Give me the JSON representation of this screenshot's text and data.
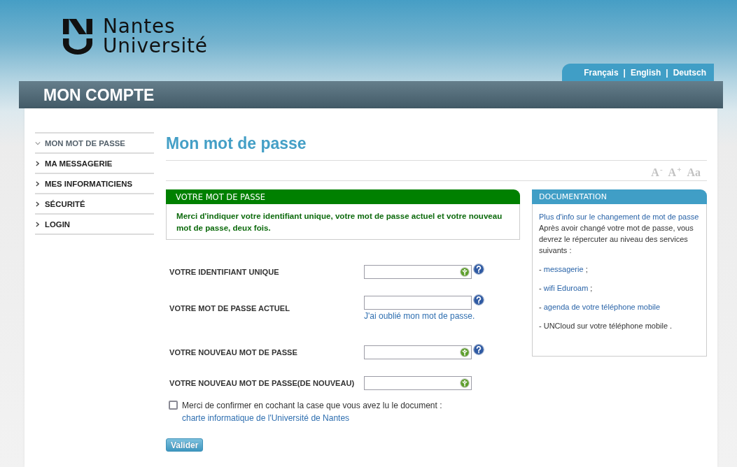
{
  "header": {
    "logo": {
      "lines": [
        "Nantes",
        "Université"
      ]
    },
    "languages": [
      {
        "kind": "link",
        "text": "Français"
      },
      {
        "kind": "separator",
        "text": "|"
      },
      {
        "kind": "link",
        "text": "English"
      },
      {
        "kind": "separator",
        "text": "|"
      },
      {
        "kind": "link",
        "text": "Deutsch"
      }
    ]
  },
  "banner": {
    "title": "MON COMPTE"
  },
  "sidebar": {
    "items": [
      {
        "label": "MON MOT DE PASSE",
        "selected": true
      },
      {
        "label": "MA MESSAGERIE",
        "selected": false
      },
      {
        "label": "MES INFORMATICIENS",
        "selected": false
      },
      {
        "label": "SÉCURITÉ",
        "selected": false
      },
      {
        "label": "LOGIN",
        "selected": false
      }
    ]
  },
  "main": {
    "title": "Mon mot de passe",
    "font_size_controls": [
      {
        "label": "A$^{-}$"
      },
      {
        "label": "A$^{+}$"
      },
      {
        "label": "Aa"
      }
    ],
    "notice": {
      "title": "VOTRE MOT DE PASSE",
      "text": "Merci d'indiquer votre identifiant unique, votre mot de passe actuel et votre nouveau mot de passe, deux fois."
    },
    "fields": [
      {
        "label": "VOTRE IDENTIFIANT UNIQUE",
        "field_icon": true,
        "help": true
      },
      {
        "label": "VOTRE MOT DE PASSE ACTUEL",
        "field_icon": false,
        "help": true,
        "link": "J'ai oublié mon mot de passe."
      },
      {
        "label": "VOTRE NOUVEAU MOT DE PASSE",
        "field_icon": true,
        "help": true
      },
      {
        "label": "VOTRE NOUVEAU MOT DE PASSE(DE NOUVEAU)",
        "field_icon": true,
        "help": false
      }
    ],
    "consent": {
      "checked": false,
      "text": "Merci de confirmer en cochant la case que vous avez lu le document : ",
      "link": "charte informatique de l'Université de Nantes"
    },
    "submit": "Valider"
  },
  "documentation": {
    "title": "DOCUMENTATION",
    "intro_link": "Plus d'info sur le changement de mot de passe",
    "intro_text": "Après avoir changé votre mot de passe, vous devrez le répercuter au niveau des services suivants :",
    "items": [
      {
        "kind": "link",
        "prefix": "- ",
        "link": "messagerie",
        "suffix": " ;"
      },
      {
        "kind": "link",
        "prefix": "- ",
        "link": "wifi Eduroam",
        "suffix": " ;"
      },
      {
        "kind": "link",
        "prefix": "- ",
        "link": "agenda de votre téléphone mobile"
      },
      {
        "kind": "text",
        "text": "- UNCloud sur votre téléphone mobile ."
      }
    ]
  }
}
